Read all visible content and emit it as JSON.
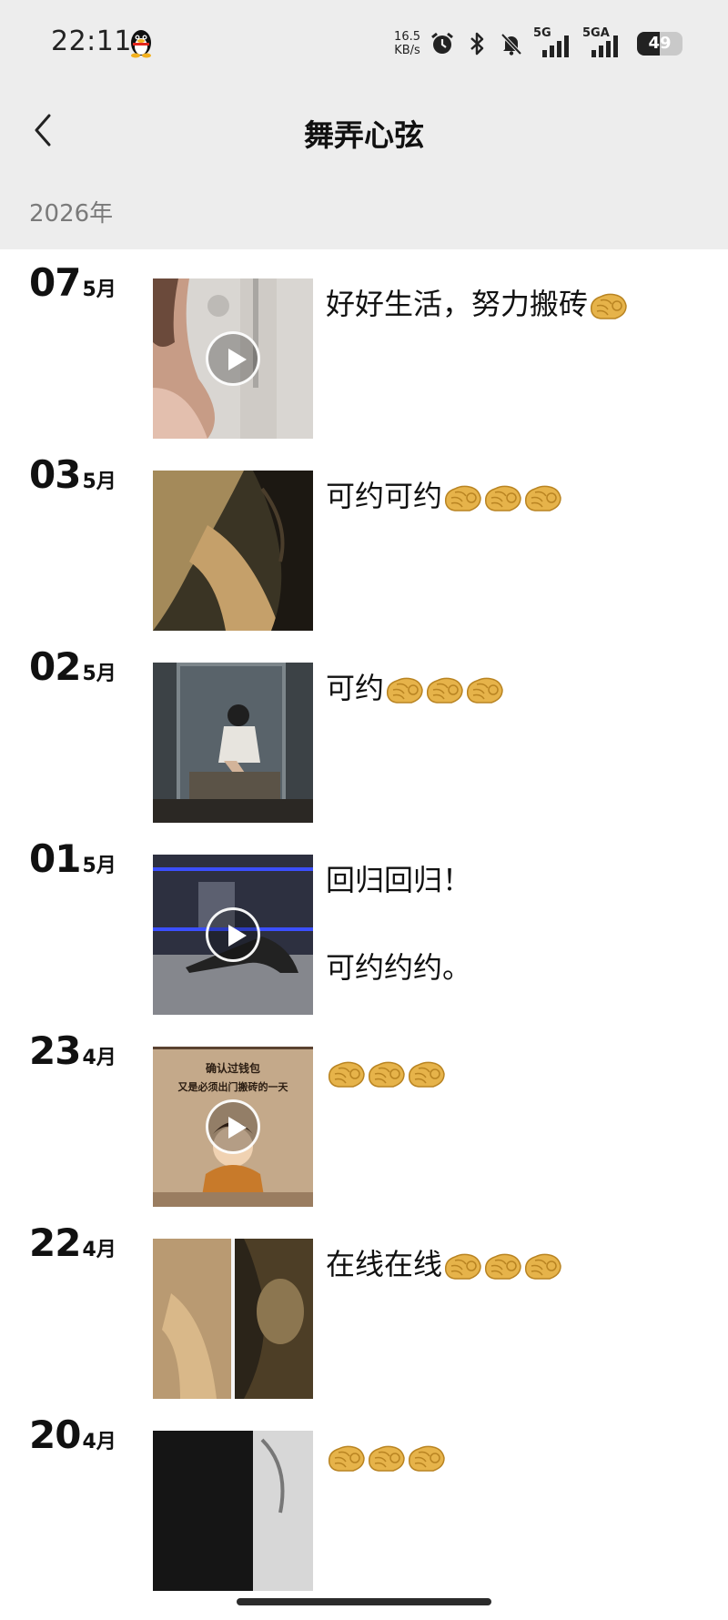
{
  "status_bar": {
    "time": "22:11",
    "speed_value": "16.5",
    "speed_unit": "KB/s",
    "network_1": "5G",
    "network_2": "5GA",
    "battery": "49",
    "battery_level": 0.49,
    "icons": [
      "qq-penguin-icon",
      "alarm-icon",
      "bluetooth-icon",
      "mute-bell-icon",
      "signal-icon",
      "battery-icon"
    ]
  },
  "header": {
    "title": "舞弄心弦",
    "back_icon": "chevron-left-icon"
  },
  "year": "2026年",
  "posts": [
    {
      "day": "07",
      "month": "5月",
      "text": "好好生活，努力搬砖",
      "emoji_count": 1,
      "is_video": true,
      "thumb": "shower"
    },
    {
      "day": "03",
      "month": "5月",
      "text": "可约可约",
      "emoji_count": 3,
      "is_video": false,
      "thumb": "closeup"
    },
    {
      "day": "02",
      "month": "5月",
      "text": "可约",
      "emoji_count": 3,
      "is_video": false,
      "thumb": "mirror"
    },
    {
      "day": "01",
      "month": "5月",
      "text": "回归回归！\n\n可约约约。",
      "emoji_count": 0,
      "is_video": true,
      "thumb": "dance"
    },
    {
      "day": "23",
      "month": "4月",
      "text": "",
      "emoji_count": 3,
      "is_video": true,
      "thumb": "poster",
      "thumb_text_1": "确认过钱包",
      "thumb_text_2": "又是必须出门搬砖的一天"
    },
    {
      "day": "22",
      "month": "4月",
      "text": "在线在线",
      "emoji_count": 3,
      "is_video": false,
      "thumb": "split"
    },
    {
      "day": "20",
      "month": "4月",
      "text": "",
      "emoji_count": 3,
      "is_video": false,
      "thumb": "dark"
    }
  ],
  "colors": {
    "header_bg": "#ededed",
    "year_text": "#7a7a7a",
    "emoji": "#e6b34a"
  }
}
